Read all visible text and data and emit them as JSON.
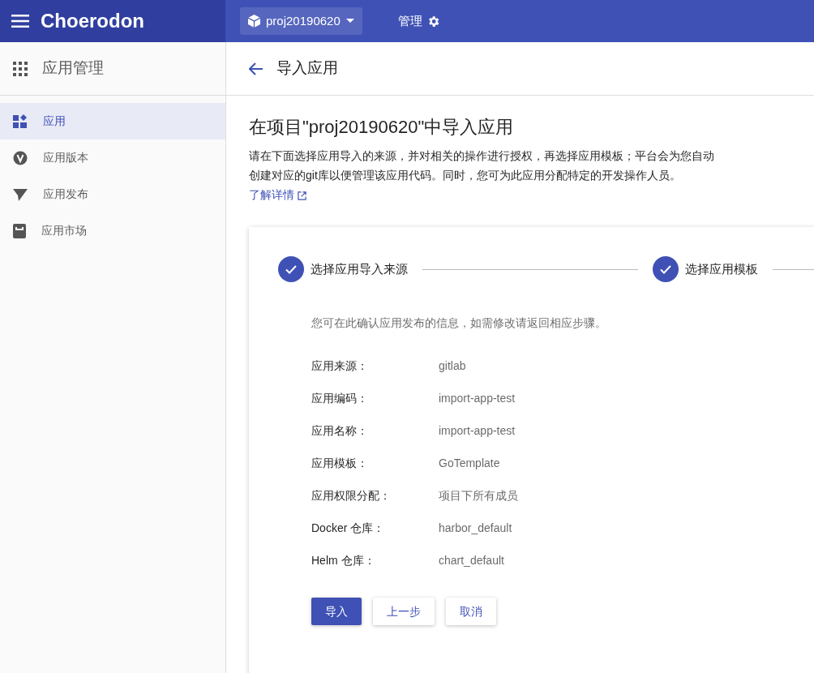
{
  "header": {
    "brand": "Choerodon",
    "project": "proj20190620",
    "manage": "管理"
  },
  "sidebar": {
    "title": "应用管理",
    "items": [
      {
        "label": "应用",
        "selected": true
      },
      {
        "label": "应用版本",
        "selected": false
      },
      {
        "label": "应用发布",
        "selected": false
      },
      {
        "label": "应用市场",
        "selected": false
      }
    ]
  },
  "page": {
    "title": "导入应用",
    "heading": "在项目\"proj20190620\"中导入应用",
    "description": "请在下面选择应用导入的来源，并对相关的操作进行授权，再选择应用模板；平台会为您自动创建对应的git库以便管理该应用代码。同时，您可为此应用分配特定的开发操作人员。",
    "link": "了解详情"
  },
  "steps": [
    {
      "label": "选择应用导入来源",
      "done": true
    },
    {
      "label": "选择应用模板",
      "done": true
    }
  ],
  "confirm_hint": "您可在此确认应用发布的信息，如需修改请返回相应步骤。",
  "fields": [
    {
      "label": "应用来源：",
      "value": "gitlab"
    },
    {
      "label": "应用编码：",
      "value": "import-app-test"
    },
    {
      "label": "应用名称：",
      "value": "import-app-test"
    },
    {
      "label": "应用模板：",
      "value": "GoTemplate"
    },
    {
      "label": "应用权限分配：",
      "value": "项目下所有成员"
    },
    {
      "label": "Docker 仓库：",
      "value": "harbor_default"
    },
    {
      "label": "Helm 仓库：",
      "value": "chart_default"
    }
  ],
  "buttons": [
    {
      "label": "导入",
      "kind": "primary"
    },
    {
      "label": "上一步",
      "kind": "default"
    },
    {
      "label": "取消",
      "kind": "default"
    }
  ]
}
